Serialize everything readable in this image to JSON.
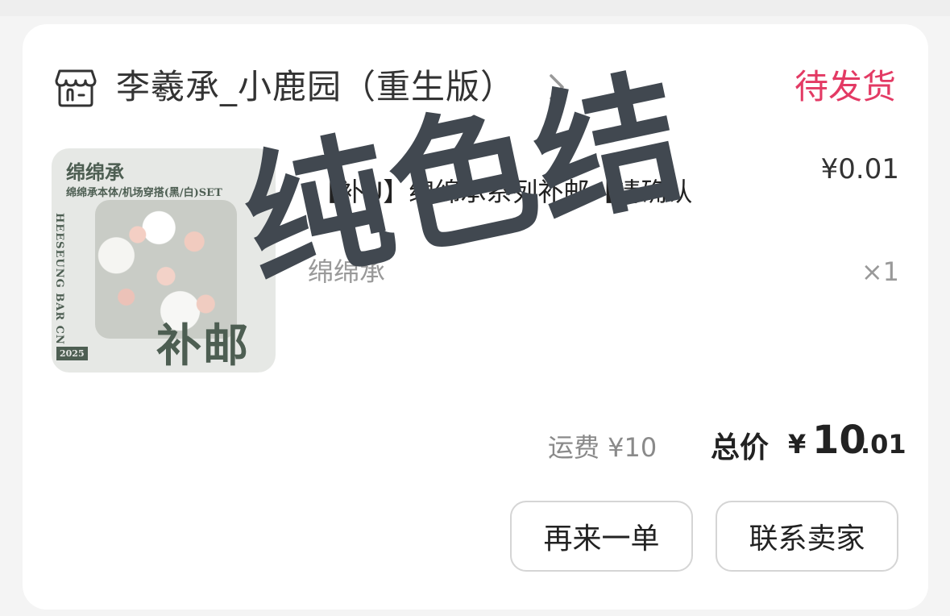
{
  "store": {
    "icon": "store-icon",
    "name": "李羲承_小鹿园（重生版）",
    "status": "待发货"
  },
  "item": {
    "thumbnail": {
      "title": "绵绵承",
      "subtitle": "绵绵承本体/机场穿搭(黑/白)SET",
      "side_text": "HEESEUNG BAR CN",
      "year": "2025",
      "stamp": "补邮"
    },
    "title": "【补U】绵绵承系列补邮【请确认",
    "spec": "绵绵承",
    "price": "¥0.01",
    "quantity": "×1"
  },
  "watermark": "纯色结",
  "summary": {
    "shipping": "运费 ¥10",
    "total_label": "总价",
    "total_currency": "¥",
    "total_integer": "10",
    "total_decimal": ".01"
  },
  "actions": {
    "reorder_label": "再来一单",
    "contact_label": "联系卖家"
  },
  "colors": {
    "status": "#e33a64",
    "watermark": "#414850"
  }
}
